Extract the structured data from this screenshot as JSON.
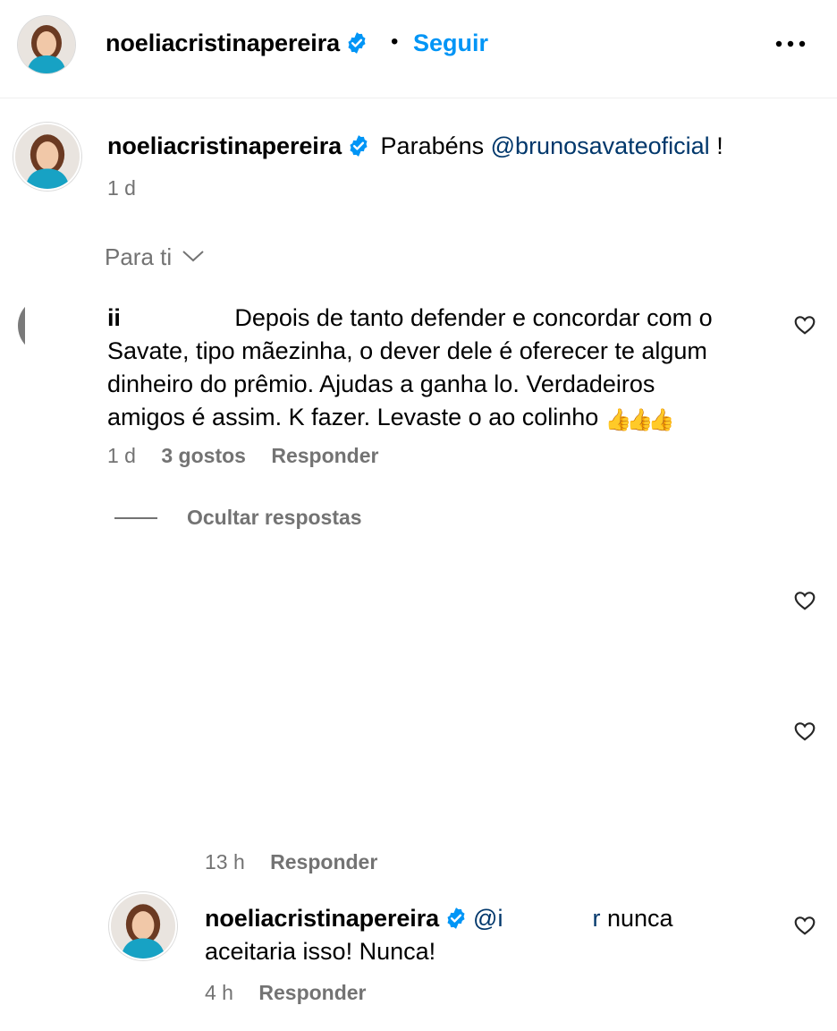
{
  "header": {
    "username": "noeliacristinapereira",
    "follow_label": "Seguir",
    "separator": "•"
  },
  "caption": {
    "username": "noeliacristinapereira",
    "text": "Parabéns ",
    "mention": "@brunosavateoficial",
    "end": " !",
    "time": "1 d"
  },
  "sort": {
    "label": "Para ti"
  },
  "comment1": {
    "username_visible": "ii",
    "line1": " Depois de tanto defender e concordar com o",
    "line2": "Savate, tipo mãezinha, o dever dele é oferecer te algum",
    "line3": "dinheiro do prêmio. Ajudas a ganha lo. Verdadeiros",
    "line4": "amigos é assim. K fazer. Levaste o ao colinho ",
    "emoji": "👍👍👍",
    "time": "1 d",
    "likes": "3 gostos",
    "reply": "Responder"
  },
  "replies_toggle": {
    "label": "Ocultar respostas"
  },
  "reply_hidden": {
    "time": "13 h",
    "reply": "Responder"
  },
  "reply_noelia": {
    "username": "noeliacristinapereira",
    "mention_start": "@i",
    "mention_end": "r",
    "text1": " nunca",
    "text2": "aceitaria isso! Nunca!",
    "time": "4 h",
    "reply": "Responder"
  },
  "colors": {
    "link_blue": "#0095f6",
    "mention_blue": "#00376b",
    "verified_blue": "#0095f6",
    "secondary_text": "#737373"
  }
}
